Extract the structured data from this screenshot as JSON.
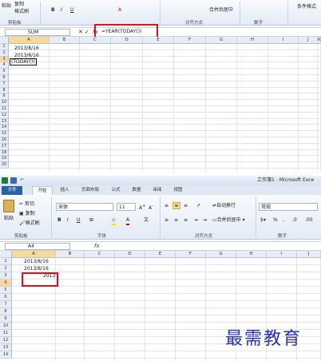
{
  "top": {
    "ribbon": {
      "paste": "粘贴",
      "copy": "复制",
      "format_painter": "格式刷",
      "clipboard_group": "剪贴板",
      "align_group": "对齐方式",
      "number_group": "数字",
      "merge_center": "合并后居中",
      "styles_label": "条件格式"
    },
    "name_box": "SUM",
    "formula": "=YEAR(TODAY())",
    "columns": [
      "A",
      "B",
      "C",
      "D",
      "E",
      "F",
      "G",
      "H",
      "I",
      "J",
      "K"
    ],
    "rows": [
      "1",
      "2",
      "3",
      "4",
      "5",
      "6",
      "7",
      "8",
      "9",
      "10",
      "11",
      "12",
      "13",
      "14",
      "15",
      "16",
      "17",
      "18",
      "19",
      "20"
    ],
    "cells": {
      "a1": "2013/8/16",
      "a2": "2013/8/16",
      "a3": "(TODAY())"
    }
  },
  "bottom": {
    "title": "工作簿1 - Microsoft Exce",
    "tabs": [
      "文件",
      "开始",
      "插入",
      "页面布局",
      "公式",
      "数据",
      "审阅",
      "视图"
    ],
    "ribbon": {
      "paste": "粘贴",
      "cut": "剪切",
      "copy": "复制",
      "format_painter": "格式刷",
      "font_name": "宋体",
      "font_size": "11",
      "wrap_text": "自动换行",
      "merge_center": "合并后居中",
      "number_format": "常规",
      "clipboard_group": "剪贴板",
      "font_group": "字体",
      "align_group": "对齐方式",
      "number_group": "数字"
    },
    "name_box": "A4",
    "formula": "",
    "columns": [
      "A",
      "B",
      "C",
      "D",
      "E",
      "F",
      "G",
      "H",
      "I",
      "J"
    ],
    "rows": [
      "1",
      "2",
      "3",
      "4",
      "5",
      "6",
      "7",
      "8",
      "9",
      "10",
      "11",
      "12",
      "13",
      "14"
    ],
    "cells": {
      "a1": "2013/8/16",
      "a2": "2013/8/16",
      "a3": "2013"
    }
  },
  "watermark": "最需教育",
  "colors": {
    "highlight": "#e0101a",
    "file_tab": "#2b5fa6",
    "watermark": "#2a2fb8"
  }
}
